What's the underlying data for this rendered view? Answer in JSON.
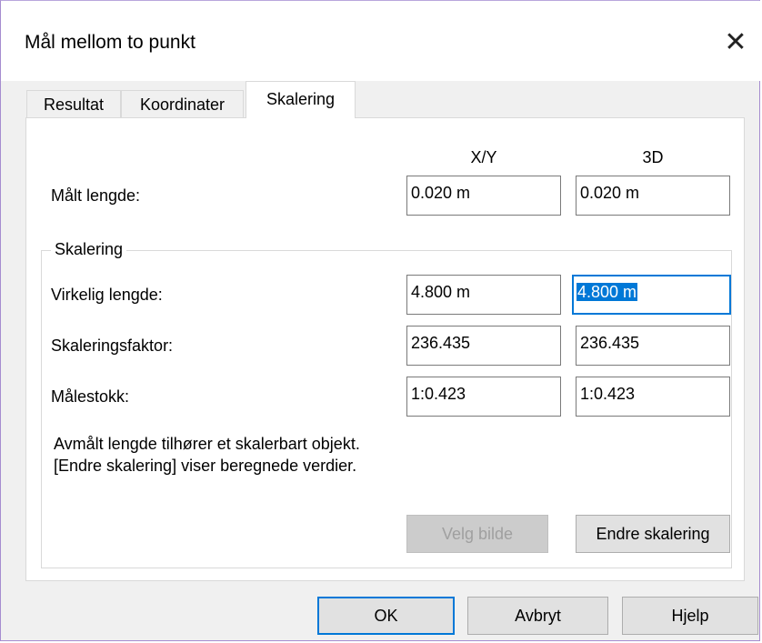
{
  "window": {
    "title": "Mål mellom to punkt"
  },
  "tabs": [
    {
      "label": "Resultat"
    },
    {
      "label": "Koordinater"
    },
    {
      "label": "Skalering"
    }
  ],
  "columns": {
    "xy": "X/Y",
    "d3": "3D"
  },
  "measured": {
    "label": "Målt lengde:",
    "xy": "0.020 m",
    "d3": "0.020 m"
  },
  "scaling_group": {
    "title": "Skalering",
    "rows": [
      {
        "label": "Virkelig lengde:",
        "xy": "4.800 m",
        "d3": "4.800 m"
      },
      {
        "label": "Skaleringsfaktor:",
        "xy": "236.435",
        "d3": "236.435"
      },
      {
        "label": "Målestokk:",
        "xy": "1:0.423",
        "d3": "1:0.423"
      }
    ],
    "note_line1": "Avmålt lengde tilhører et skalerbart objekt.",
    "note_line2": "[Endre skalering] viser beregnede verdier.",
    "select_image_button": "Velg bilde",
    "change_scaling_button": "Endre skalering"
  },
  "footer": {
    "ok": "OK",
    "cancel": "Avbryt",
    "help": "Hjelp"
  },
  "colors": {
    "accent": "#0078d7",
    "selection": "#0078d7"
  }
}
